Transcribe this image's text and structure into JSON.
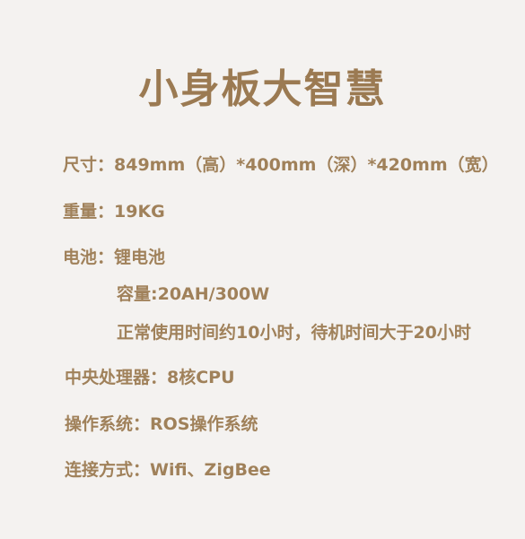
{
  "title": "小身板大智慧",
  "specs": [
    {
      "key": "size",
      "text": "尺寸：849mm（高）*400mm（深）*420mm（宽）"
    },
    {
      "key": "weight",
      "text": "重量：19KG"
    },
    {
      "key": "battery",
      "text": "电池：锂电池"
    },
    {
      "key": "capacity",
      "text": "容量:20AH/300W"
    },
    {
      "key": "runtime",
      "text": "正常使用时间约10小时，待机时间大于20小时"
    },
    {
      "key": "cpu",
      "text": "中央处理器：8核CPU"
    },
    {
      "key": "os",
      "text": "操作系统：ROS操作系统"
    },
    {
      "key": "connectivity",
      "text": "连接方式：Wifi、ZigBee"
    }
  ]
}
